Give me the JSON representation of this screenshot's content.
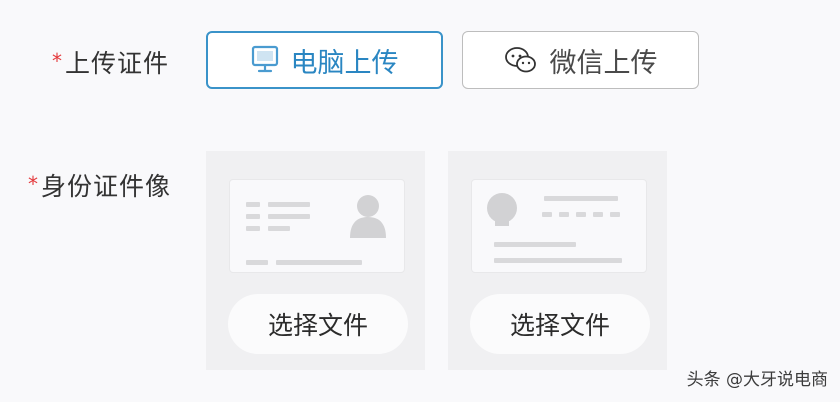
{
  "upload_section": {
    "required_mark": "*",
    "label": "上传证件",
    "buttons": {
      "pc": {
        "label": "电脑上传",
        "icon": "monitor-icon",
        "selected": true,
        "color": "#2a86c2"
      },
      "wechat": {
        "label": "微信上传",
        "icon": "wechat-icon",
        "selected": false,
        "color": "#4a4a4a"
      }
    }
  },
  "id_section": {
    "required_mark": "*",
    "label": "身份证件像",
    "front": {
      "button_label": "选择文件",
      "placeholder_icon": "id-card-front-icon"
    },
    "back": {
      "button_label": "选择文件",
      "placeholder_icon": "id-card-back-icon"
    }
  },
  "watermark": {
    "text": "头条 @大牙说电商"
  }
}
